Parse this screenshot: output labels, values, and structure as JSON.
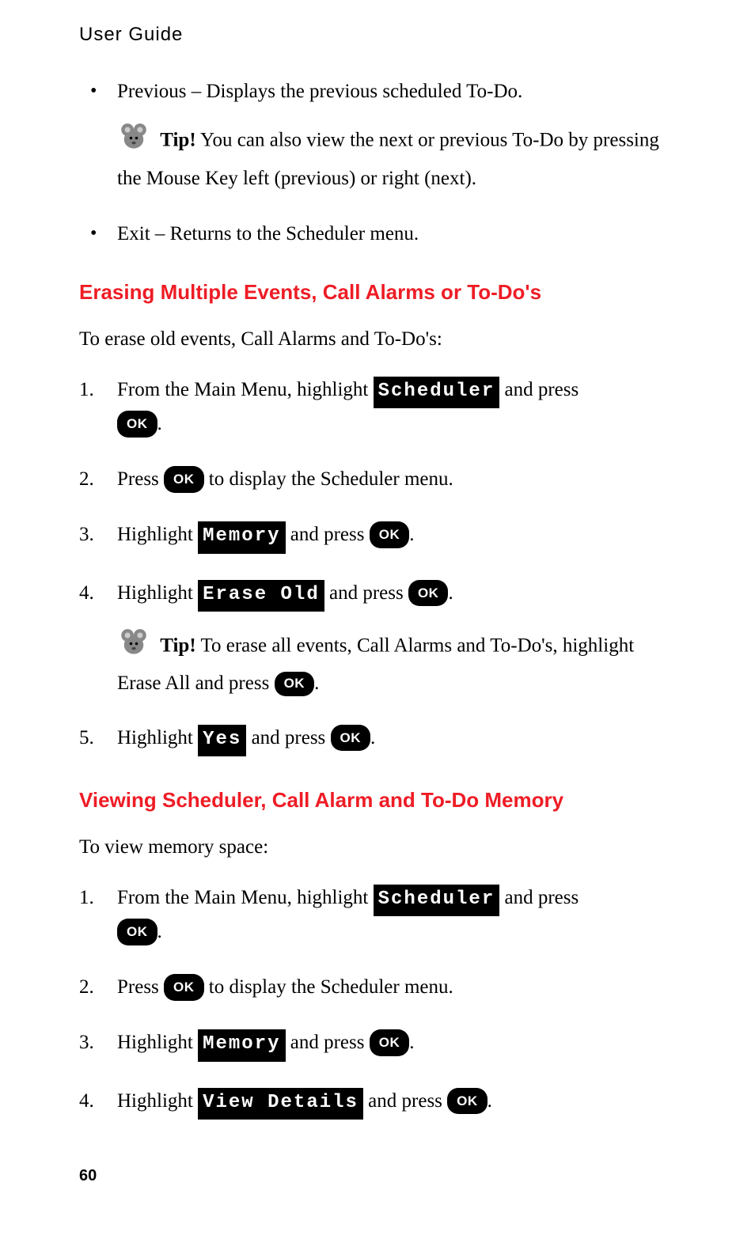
{
  "header": "User Guide",
  "page_number": "60",
  "ok_label": "OK",
  "tip_label": "Tip!",
  "bullets": [
    {
      "text_prefix": "Previous – Displays the previous scheduled To-Do.",
      "tip": "You can also view the next or previous To-Do by pressing the Mouse Key left (previous) or right (next)."
    },
    {
      "text_prefix": "Exit – Returns to the Scheduler menu."
    }
  ],
  "section1": {
    "heading": "Erasing Multiple Events, Call Alarms or To-Do's",
    "intro": "To erase old events, Call Alarms and To-Do's:",
    "steps": [
      {
        "pre": "From the Main Menu, highlight ",
        "lcd": "Scheduler",
        "post": " and press "
      },
      {
        "pre": "Press ",
        "post": " to display the Scheduler menu."
      },
      {
        "pre": "Highlight ",
        "lcd": "Memory",
        "post": " and press "
      },
      {
        "pre": "Highlight ",
        "lcd": "Erase Old",
        "post": " and press ",
        "tip_pre": "To erase all events, Call Alarms and To-Do's, highlight Erase All and press "
      },
      {
        "pre": "Highlight ",
        "lcd": "Yes",
        "post": " and press "
      }
    ]
  },
  "section2": {
    "heading": "Viewing Scheduler, Call Alarm and To-Do Memory",
    "intro": "To view memory space:",
    "steps": [
      {
        "pre": "From the Main Menu, highlight ",
        "lcd": "Scheduler",
        "post": " and press "
      },
      {
        "pre": "Press ",
        "post": " to display the Scheduler menu."
      },
      {
        "pre": "Highlight ",
        "lcd": "Memory",
        "post": " and press "
      },
      {
        "pre": "Highlight ",
        "lcd": "View Details",
        "post": " and press "
      }
    ]
  }
}
